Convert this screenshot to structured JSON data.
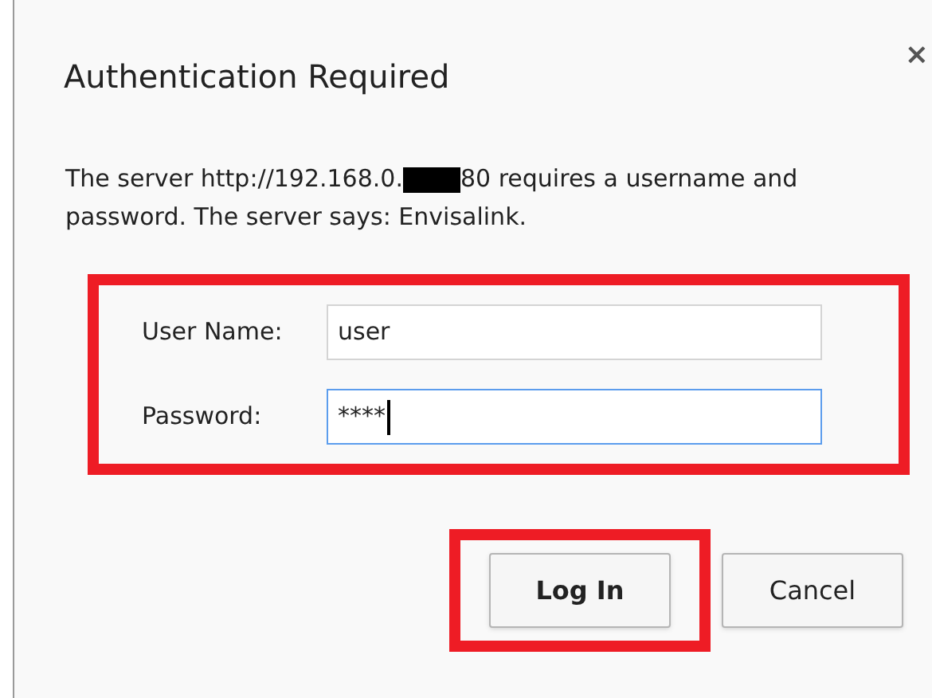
{
  "dialog": {
    "title": "Authentication Required",
    "close": "×",
    "message_start": "The server http://192.168.0.",
    "redacted": true,
    "message_end": "80 requires a username and",
    "message_line2": "password. The server says: Envisalink."
  },
  "form": {
    "highlighted": true,
    "fields": [
      {
        "label": "User Name:",
        "value": "user",
        "focused": false
      },
      {
        "label": "Password:",
        "value": "****",
        "focused": true
      }
    ]
  },
  "buttons": [
    {
      "label": "Log In",
      "primary": true,
      "highlighted": true
    },
    {
      "label": "Cancel",
      "primary": false,
      "highlighted": false
    }
  ]
}
